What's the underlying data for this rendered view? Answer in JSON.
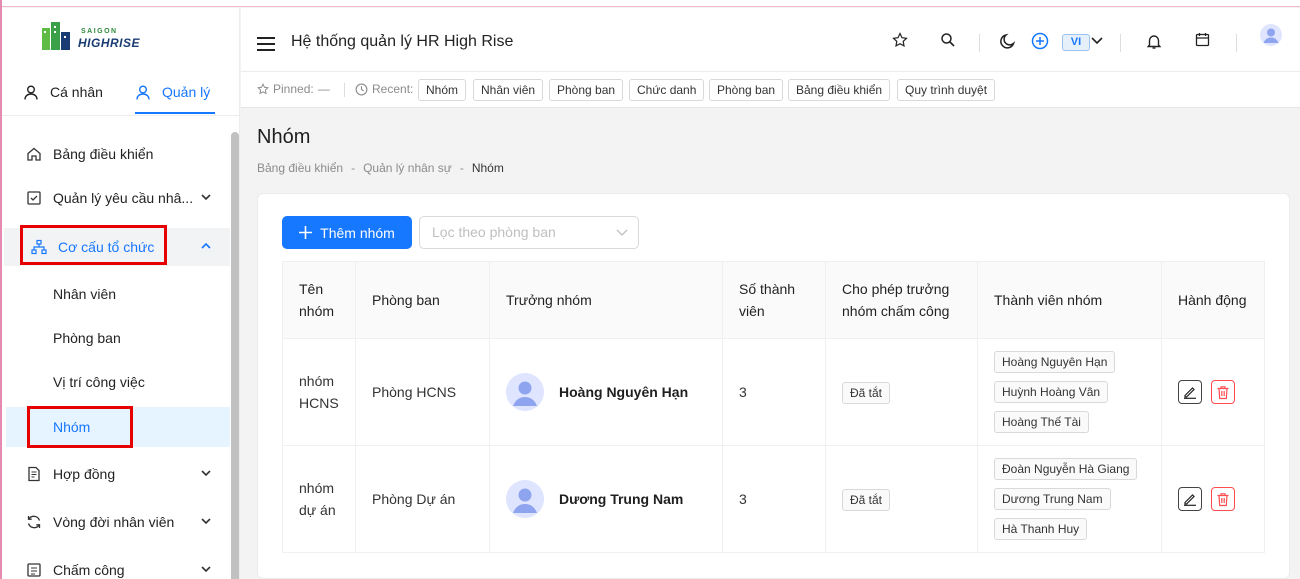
{
  "app": {
    "logo_top": "SAIGON",
    "logo_bottom": "HIGHRISE",
    "title": "Hệ thống quản lý HR High Rise",
    "lang": "VI"
  },
  "sidebar": {
    "tabs": {
      "personal": "Cá nhân",
      "manage": "Quản lý"
    },
    "items": [
      {
        "label": "Bảng điều khiển"
      },
      {
        "label": "Quản lý yêu cầu nhâ..."
      },
      {
        "label": "Cơ cấu tổ chức"
      },
      {
        "label": "Nhân viên"
      },
      {
        "label": "Phòng ban"
      },
      {
        "label": "Vị trí công việc"
      },
      {
        "label": "Nhóm"
      },
      {
        "label": "Hợp đồng"
      },
      {
        "label": "Vòng đời nhân viên"
      },
      {
        "label": "Chấm công"
      }
    ]
  },
  "recent": {
    "pinned_label": "Pinned:",
    "pinned_value": "—",
    "recent_label": "Recent:",
    "chips": [
      "Nhóm",
      "Nhân viên",
      "Phòng ban",
      "Chức danh",
      "Phòng ban",
      "Bảng điều khiển",
      "Quy trình duyệt"
    ]
  },
  "page": {
    "title": "Nhóm",
    "breadcrumb": [
      "Bảng điều khiển",
      "-",
      "Quản lý nhân sự",
      "-",
      "Nhóm"
    ]
  },
  "toolbar": {
    "add_label": "Thêm nhóm",
    "filter_placeholder": "Lọc theo phòng ban"
  },
  "table": {
    "headers": {
      "name": "Tên nhóm",
      "dept": "Phòng ban",
      "leader": "Trưởng nhóm",
      "count": "Số thành viên",
      "allow": "Cho phép trưởng nhóm chấm công",
      "members": "Thành viên nhóm",
      "actions": "Hành động"
    },
    "rows": [
      {
        "name": "nhóm HCNS",
        "dept": "Phòng HCNS",
        "leader": "Hoàng Nguyên Hạn",
        "count": "3",
        "allow": "Đã tắt",
        "members": [
          "Hoàng Nguyên Hạn",
          "Huỳnh Hoàng Vân",
          "Hoàng Thế Tài"
        ]
      },
      {
        "name": "nhóm dự án",
        "dept": "Phòng Dự án",
        "leader": "Dương Trung Nam",
        "count": "3",
        "allow": "Đã tắt",
        "members": [
          "Đoàn Nguyễn Hà Giang",
          "Dương Trung Nam",
          "Hà Thanh Huy"
        ]
      }
    ]
  },
  "colors": {
    "accent": "#1677ff",
    "danger": "#ff4d4f",
    "highlight_box": "#e60000"
  }
}
